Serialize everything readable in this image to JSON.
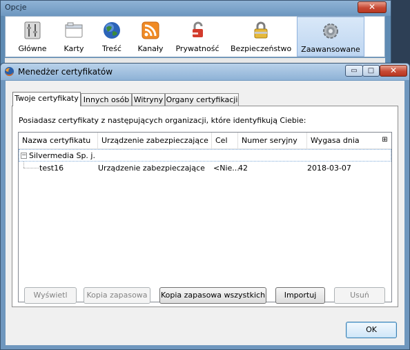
{
  "options_window": {
    "title": "Opcje",
    "close_glyph": "✕",
    "toolbar": [
      {
        "label": "Główne",
        "icon": "general-icon"
      },
      {
        "label": "Karty",
        "icon": "tabs-icon"
      },
      {
        "label": "Treść",
        "icon": "content-icon"
      },
      {
        "label": "Kanały",
        "icon": "feeds-icon"
      },
      {
        "label": "Prywatność",
        "icon": "privacy-icon"
      },
      {
        "label": "Bezpieczeństwo",
        "icon": "security-icon"
      },
      {
        "label": "Zaawansowane",
        "icon": "advanced-icon",
        "active": true
      }
    ]
  },
  "cert_manager": {
    "title": "Menedżer certyfikatów",
    "min_glyph": "▭",
    "max_glyph": "□",
    "close_glyph": "✕",
    "tabs": [
      {
        "label": "Twoje certyfikaty",
        "active": true
      },
      {
        "label": "Innych osób"
      },
      {
        "label": "Witryny"
      },
      {
        "label": "Organy certyfikacji"
      }
    ],
    "description": "Posiadasz certyfikaty z następujących organizacji, które identyfikują Ciebie:",
    "columns": [
      "Nazwa certyfikatu",
      "Urządzenie zabezpieczające",
      "Cel",
      "Numer seryjny",
      "Wygasa dnia"
    ],
    "column_picker_glyph": "⊞",
    "expand_glyph": "−",
    "groups": [
      {
        "name": "Silvermedia Sp. j.",
        "rows": [
          {
            "name": "test16",
            "device": "Urządzenie zabezpieczające",
            "purpose": "<Nie...",
            "serial": "42",
            "expires": "2018-03-07"
          }
        ]
      }
    ],
    "buttons": {
      "view": "Wyświetl",
      "backup": "Kopia zapasowa",
      "backup_all": "Kopia zapasowa wszystkich",
      "import": "Importuj",
      "delete": "Usuń",
      "ok": "OK"
    }
  },
  "colors": {
    "desktop": "#2d3f55",
    "titlebar": "#8eb2d6",
    "close_red": "#c74a35",
    "dialog_face": "#f0f0f0",
    "selection_border": "#7aa7d8"
  }
}
